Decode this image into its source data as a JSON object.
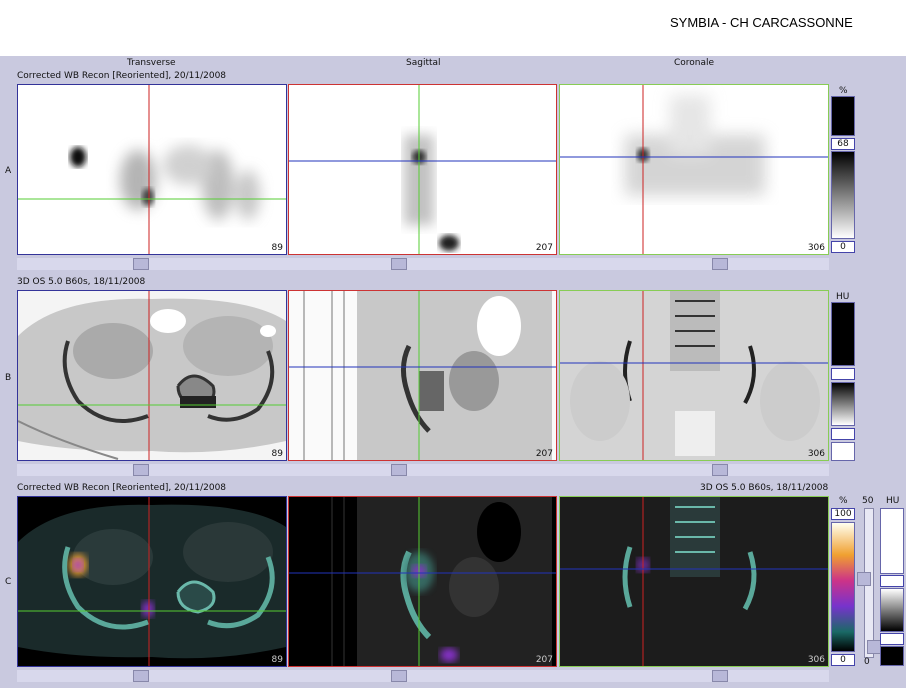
{
  "header": {
    "site": "SYMBIA - CH CARCASSONNE"
  },
  "views": {
    "transverse": "Transverse",
    "sagittal": "Sagittal",
    "coronal": "Coronale"
  },
  "rows": {
    "a": {
      "label": "A",
      "title": "Corrected WB Recon [Reoriented], 20/11/2008",
      "slices": [
        "89",
        "207",
        "306"
      ],
      "scale": {
        "unit": "%",
        "top": "68",
        "bottom": "0"
      }
    },
    "b": {
      "label": "B",
      "title": "3D  OS  5.0  B60s, 18/11/2008",
      "slices": [
        "89",
        "207",
        "306"
      ],
      "scale": {
        "unit": "HU"
      }
    },
    "c": {
      "label": "C",
      "title_left": "Corrected WB Recon [Reoriented], 20/11/2008",
      "title_right": "3D  OS  5.0  B60s, 18/11/2008",
      "slices": [
        "89",
        "207",
        "306"
      ],
      "scale": {
        "unit": "%",
        "top": "100",
        "bottom": "0",
        "mix_top": "50",
        "mix_bottom": "0",
        "unit2": "HU"
      }
    }
  },
  "colors": {
    "crosshair_red": "#cc2222",
    "crosshair_green": "#55cc33",
    "crosshair_blue": "#2233bb",
    "frame_blue": "#333399",
    "frame_red": "#cc3333",
    "frame_green": "#88cc55"
  }
}
